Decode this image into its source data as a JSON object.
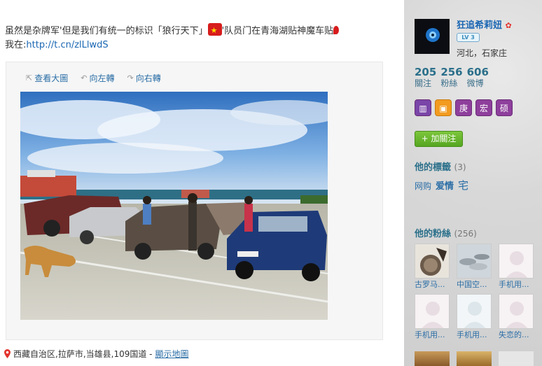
{
  "post": {
    "text_before": "虽然是杂牌军'但是我们有统一的标识「狼行天下」",
    "text_after": "'队员门在青海湖贴神魔车贴",
    "find_label": "我在:",
    "link": "http://t.cn/zlLlwdS"
  },
  "media": {
    "tools": [
      "查看大圖",
      "向左轉",
      "向右轉"
    ]
  },
  "location": {
    "text": "西藏自治区,拉萨市,当雄县,109国道 - ",
    "map_link": "顯示地圖"
  },
  "profile": {
    "username": "狂追希莉妞",
    "level": "LV 3",
    "location": "河北，石家庄",
    "stats": [
      {
        "num": "205",
        "label": "關注"
      },
      {
        "num": "256",
        "label": "粉絲"
      },
      {
        "num": "606",
        "label": "微博"
      }
    ],
    "badges": [
      "",
      "",
      "庚",
      "宏",
      "硕"
    ],
    "follow_label": "+ 加關注"
  },
  "tags_section": {
    "title": "他的標籤",
    "count": "(3)",
    "tags": [
      "网购",
      "爱情",
      "宅"
    ]
  },
  "fans_section": {
    "title": "他的粉絲",
    "count": "(256)",
    "fans": [
      {
        "name": "古罗马..."
      },
      {
        "name": "中国空..."
      },
      {
        "name": "手机用..."
      },
      {
        "name": "手机用..."
      },
      {
        "name": "手机用..."
      },
      {
        "name": "失恋的..."
      }
    ]
  },
  "colors": {
    "link": "#2b6ea6",
    "follow_green": "#56a621",
    "badge_purple": "#8e3f9c"
  }
}
